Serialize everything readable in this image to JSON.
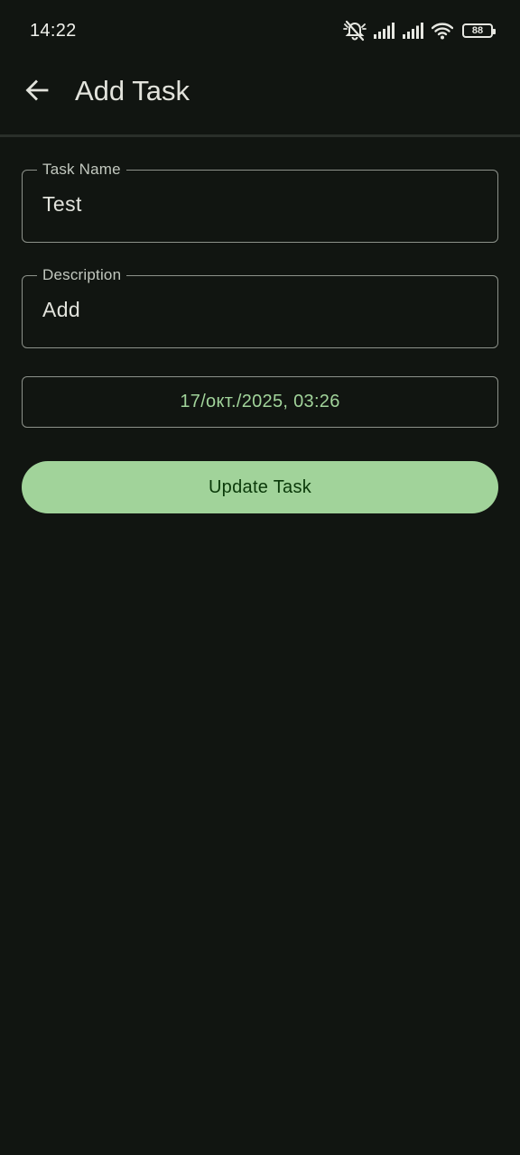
{
  "status_bar": {
    "time": "14:22",
    "battery_level": "88",
    "icons": [
      "vibrate-mute-icon",
      "signal-icon",
      "signal-icon",
      "wifi-icon",
      "battery-icon"
    ]
  },
  "app_bar": {
    "title": "Add Task",
    "back_icon": "arrow-back-icon"
  },
  "form": {
    "task_name": {
      "label": "Task Name",
      "value": "Test"
    },
    "description": {
      "label": "Description",
      "value": "Add"
    },
    "date_time": "17/окт./2025, 03:26",
    "submit_label": "Update Task"
  },
  "colors": {
    "background": "#111511",
    "accent": "#a1d39a",
    "on_accent": "#0a3909",
    "outline": "#8d928b",
    "text": "#e2e3dc"
  }
}
